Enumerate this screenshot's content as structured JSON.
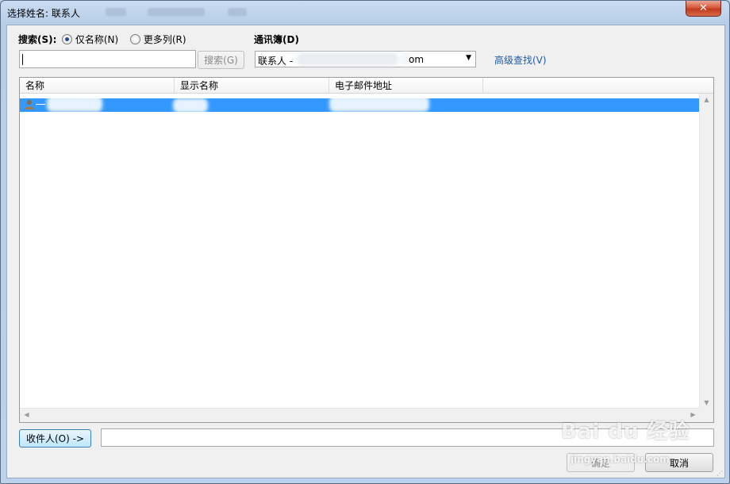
{
  "window": {
    "title": "选择姓名: 联系人",
    "close_glyph": "✕"
  },
  "search": {
    "label": "搜索(S):",
    "option_name_only": "仅名称(N)",
    "option_more_columns": "更多列(R)",
    "selected_option": "仅名称(N)",
    "input_value": "",
    "button_label": "搜索(G)"
  },
  "address_book": {
    "label": "通讯簿(D)",
    "selected_prefix": "联系人 - ",
    "selected_suffix": "om",
    "advanced_find": "高级查找(V)"
  },
  "list": {
    "columns": [
      "名称",
      "显示名称",
      "电子邮件地址"
    ],
    "icons": {
      "contact": "person-icon",
      "up": "scroll-up-arrow-icon",
      "down": "scroll-down-arrow-icon",
      "left": "scroll-left-arrow-icon",
      "right": "scroll-right-arrow-icon"
    }
  },
  "recipients": {
    "button_label": "收件人(O) ->",
    "field_value": ""
  },
  "footer": {
    "ok_label": "确定",
    "cancel_label": "取消"
  },
  "watermark": {
    "brand": "Bai du 经验",
    "url": "jingyan.baidu.com"
  },
  "colors": {
    "selection": "#3399ff",
    "link": "#1e5aa8",
    "close": "#c8472a"
  }
}
